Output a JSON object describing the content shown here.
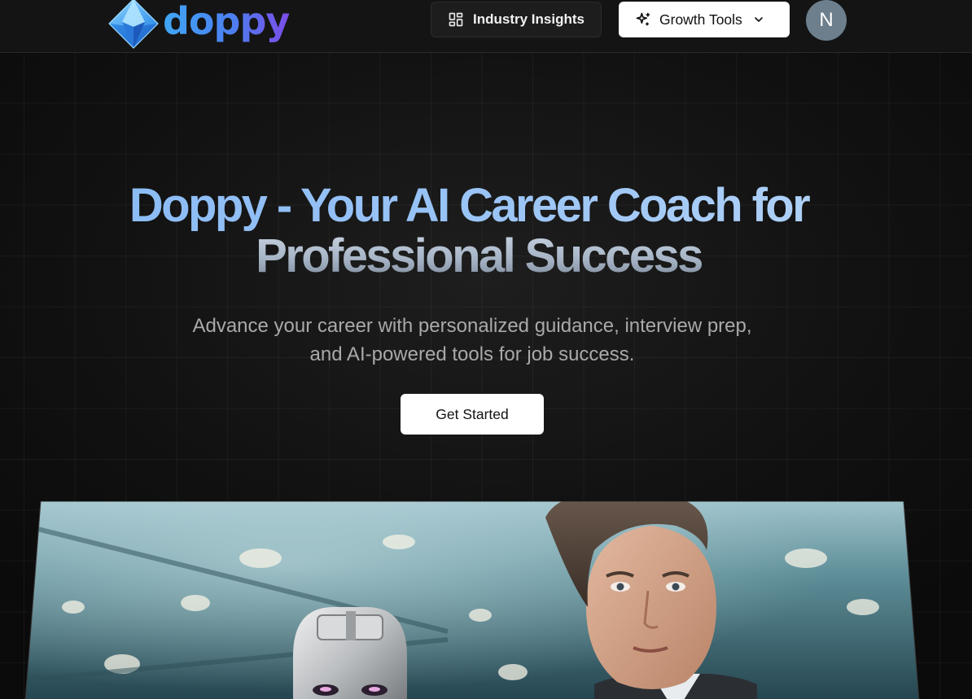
{
  "header": {
    "logo_text": "doppy",
    "nav": {
      "insights_label": "Industry Insights",
      "growth_label": "Growth Tools"
    },
    "avatar_initial": "N"
  },
  "hero": {
    "title_line1": "Doppy - Your AI Career Coach for",
    "title_line2": "Professional Success",
    "subtitle": "Advance your career with personalized guidance, interview prep, and AI-powered tools for job success.",
    "cta_label": "Get Started"
  },
  "banner": {
    "description_icons": [
      "robot-figure",
      "businessman-figure"
    ]
  },
  "colors": {
    "brand_blue": "#3fa7f5",
    "brand_purple": "#7b4de8",
    "title_blue": "#87b9f4",
    "avatar_bg": "#6d7f8c",
    "background": "#111111"
  },
  "icons": {
    "insights": "layout-dashboard-icon",
    "growth": "sparkles-icon",
    "growth_dropdown": "chevron-down-icon"
  }
}
